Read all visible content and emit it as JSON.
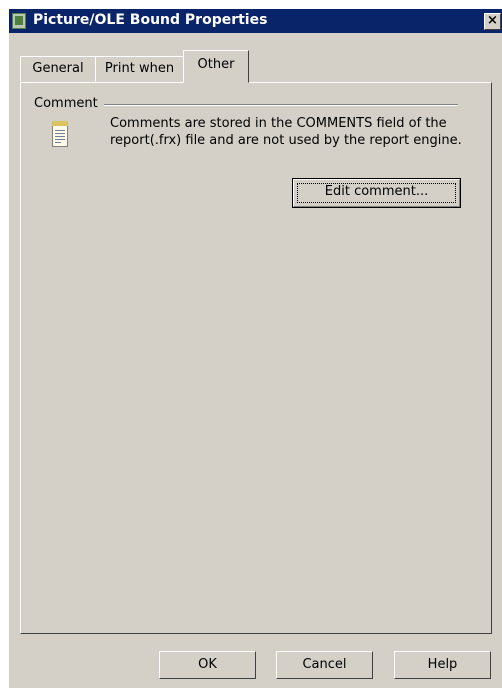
{
  "window": {
    "title": "Picture/OLE Bound Properties",
    "close_glyph": "×"
  },
  "tabs": [
    {
      "label": "General"
    },
    {
      "label": "Print when"
    },
    {
      "label": "Other"
    }
  ],
  "active_tab": "Other",
  "comment_group": {
    "label": "Comment",
    "description": "Comments are stored in the COMMENTS field of the report(.frx) file and are not used by the report engine.",
    "icon": "notepad-icon",
    "edit_button": "Edit comment..."
  },
  "footer": {
    "ok": "OK",
    "cancel": "Cancel",
    "help": "Help"
  },
  "colors": {
    "title_bar": "#0a246a",
    "face": "#d4d0c8"
  }
}
